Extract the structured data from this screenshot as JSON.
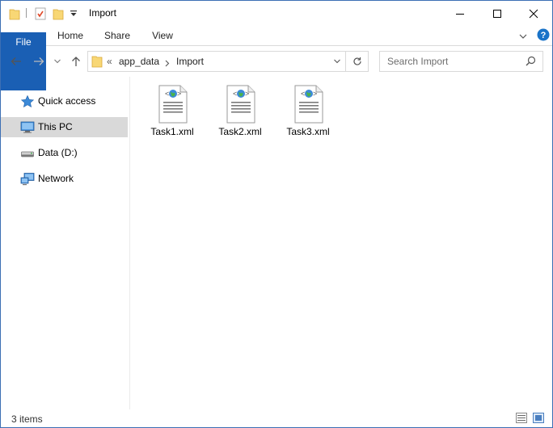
{
  "window": {
    "title": "Import"
  },
  "ribbon": {
    "tabs": [
      "File",
      "Home",
      "Share",
      "View"
    ]
  },
  "nav": {
    "overflow_label": "«",
    "path": [
      "app_data",
      "Import"
    ],
    "search_placeholder": "Search Import"
  },
  "sidebar": {
    "items": [
      {
        "label": "Quick access",
        "icon": "star-icon"
      },
      {
        "label": "This PC",
        "icon": "computer-icon",
        "selected": true
      },
      {
        "label": "Data (D:)",
        "icon": "drive-icon"
      },
      {
        "label": "Network",
        "icon": "network-icon"
      }
    ]
  },
  "files": [
    {
      "name": "Task1.xml",
      "icon": "xml-file-icon"
    },
    {
      "name": "Task2.xml",
      "icon": "xml-file-icon"
    },
    {
      "name": "Task3.xml",
      "icon": "xml-file-icon"
    }
  ],
  "status": {
    "items_text": "3 items"
  },
  "colors": {
    "file_tab": "#1a5fb4",
    "selected": "#d9d9d9",
    "folder": "#f8d775",
    "accent": "#1a73c8"
  }
}
